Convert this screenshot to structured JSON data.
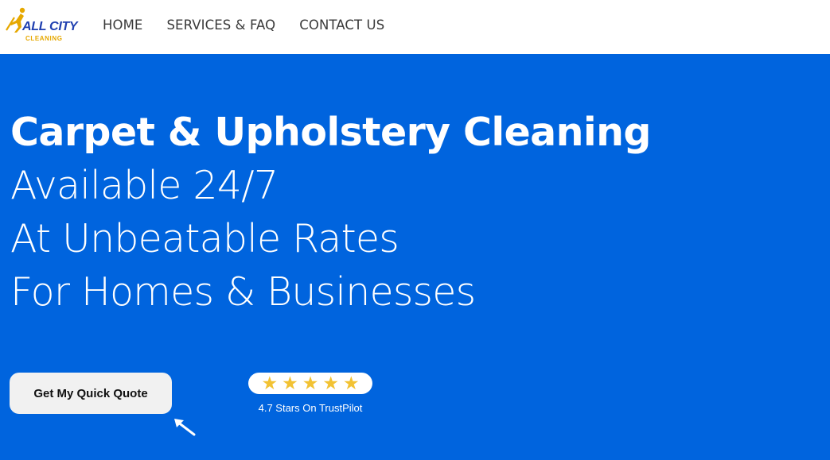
{
  "logo": {
    "name_main": "ALL CITY",
    "name_sub": "CLEANING",
    "colors": {
      "blue": "#1f3fb0",
      "gold": "#e6a800"
    }
  },
  "nav": {
    "items": [
      {
        "label": "HOME"
      },
      {
        "label": "SERVICES & FAQ"
      },
      {
        "label": "CONTACT US"
      }
    ]
  },
  "hero": {
    "background": "#0064de",
    "headline": "Carpet & Upholstery Cleaning",
    "sublines": [
      "Available 24/7",
      "At Unbeatable Rates",
      "For Homes & Businesses"
    ],
    "cta_label": "Get My Quick Quote",
    "cta_icon": "arrow-up-left-icon",
    "rating": {
      "stars": 5,
      "star_icon": "star-icon",
      "star_color": "#f2c233",
      "text": "4.7 Stars On TrustPilot"
    }
  }
}
